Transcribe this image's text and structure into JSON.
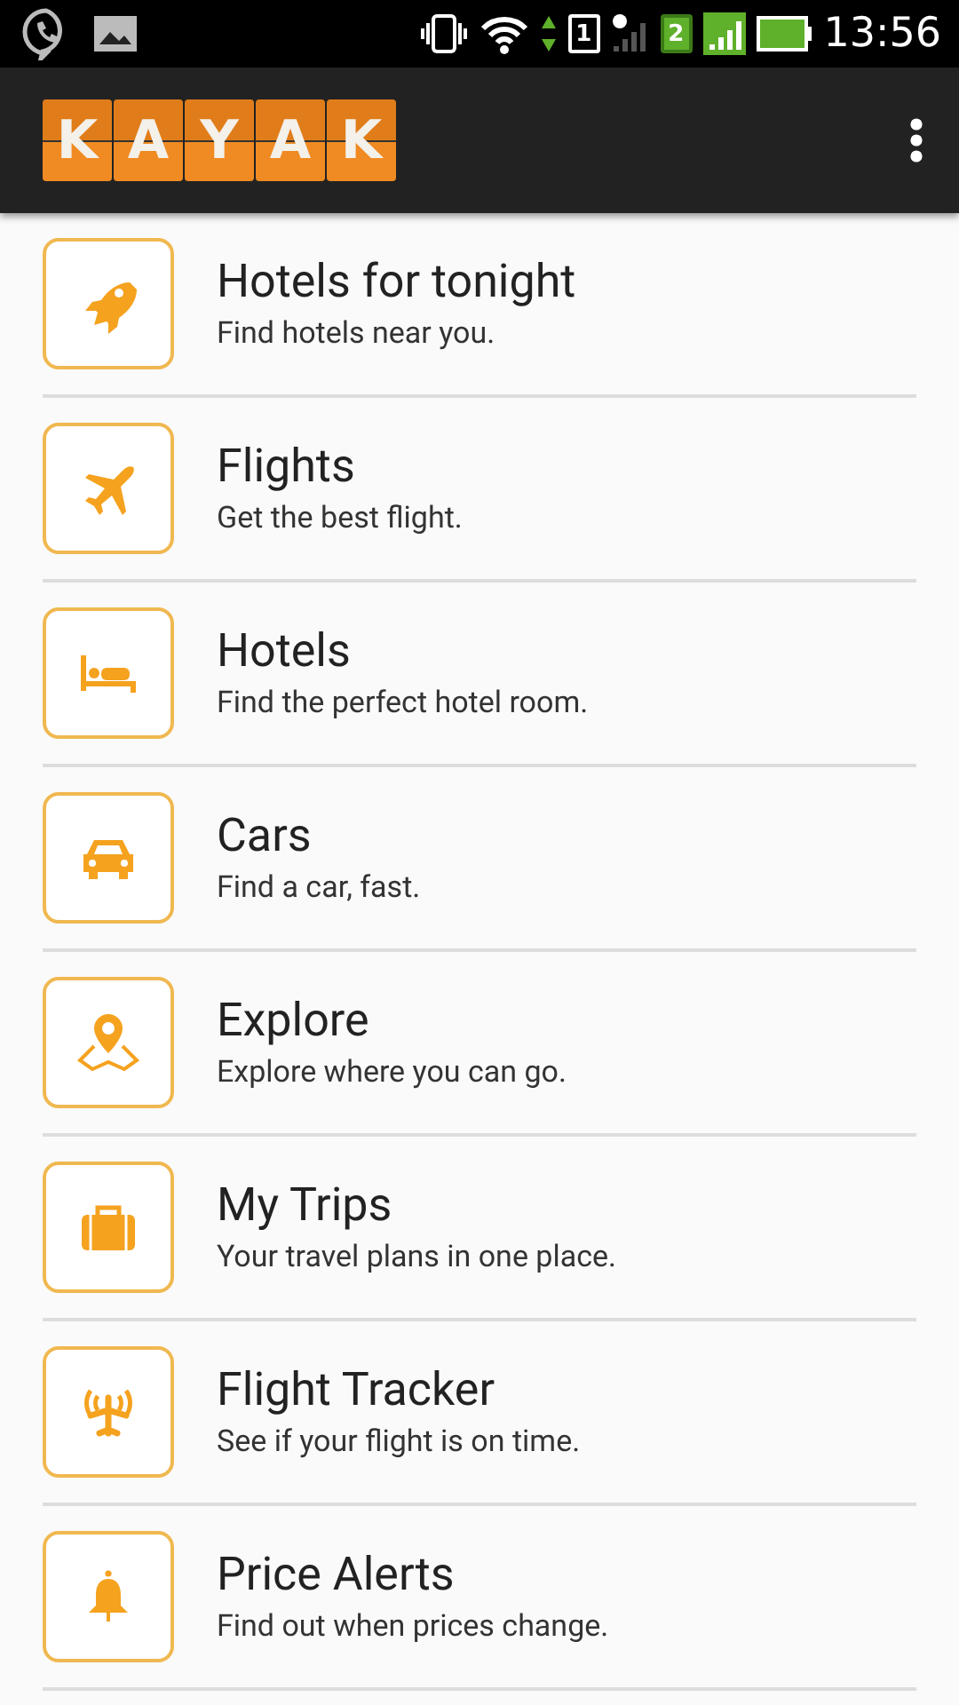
{
  "status_bar": {
    "sim_1": "1",
    "sim_2": "2",
    "time": "13:56"
  },
  "app_bar": {
    "logo_letters": [
      "K",
      "A",
      "Y",
      "A",
      "K"
    ]
  },
  "menu": [
    {
      "kind": "rocket",
      "title": "Hotels for tonight",
      "subtitle": "Find hotels near you."
    },
    {
      "kind": "plane",
      "title": "Flights",
      "subtitle": "Get the best flight."
    },
    {
      "kind": "bed",
      "title": "Hotels",
      "subtitle": "Find the perfect hotel room."
    },
    {
      "kind": "car",
      "title": "Cars",
      "subtitle": "Find a car, fast."
    },
    {
      "kind": "map",
      "title": "Explore",
      "subtitle": "Explore where you can go."
    },
    {
      "kind": "suitcase",
      "title": "My Trips",
      "subtitle": "Your travel plans in one place."
    },
    {
      "kind": "tracker",
      "title": "Flight Tracker",
      "subtitle": "See if your flight is on time."
    },
    {
      "kind": "bell",
      "title": "Price Alerts",
      "subtitle": "Find out when prices change."
    }
  ]
}
